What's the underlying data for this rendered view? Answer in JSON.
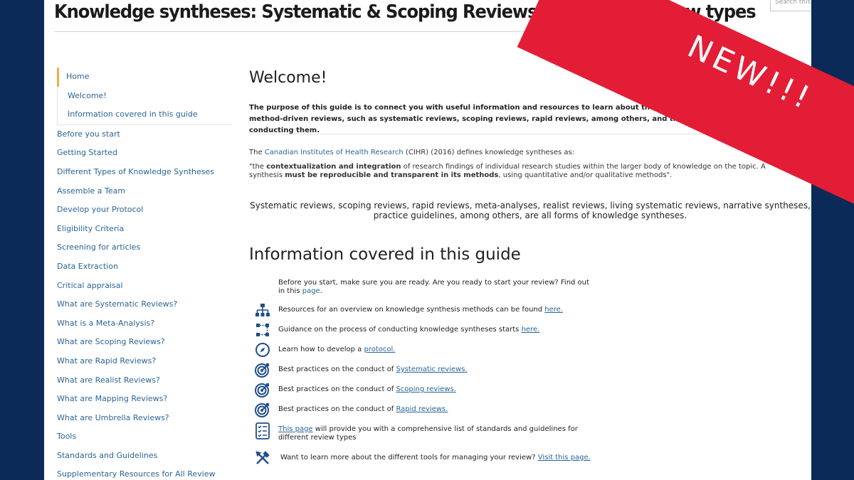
{
  "header": {
    "title": "Knowledge syntheses: Systematic & Scoping Reviews, and other review types",
    "search_placeholder": "Search this"
  },
  "banner": {
    "text": "NEW!!!",
    "color": "#e31d36"
  },
  "sidebar": {
    "items": [
      {
        "label": "Home",
        "type": "home"
      },
      {
        "label": "Welcome!",
        "type": "sub"
      },
      {
        "label": "Information covered in this guide",
        "type": "sub-last"
      },
      {
        "label": "Before you start",
        "type": "top"
      },
      {
        "label": "Getting Started",
        "type": "top"
      },
      {
        "label": "Different Types of Knowledge Syntheses",
        "type": "top"
      },
      {
        "label": "Assemble a Team",
        "type": "top"
      },
      {
        "label": "Develop your Protocol",
        "type": "top"
      },
      {
        "label": "Eligibility Criteria",
        "type": "top"
      },
      {
        "label": "Screening for articles",
        "type": "top"
      },
      {
        "label": "Data Extraction",
        "type": "top"
      },
      {
        "label": "Critical appraisal",
        "type": "top"
      },
      {
        "label": "What are Systematic Reviews?",
        "type": "top"
      },
      {
        "label": "What is a Meta-Analysis?",
        "type": "top"
      },
      {
        "label": "What are Scoping Reviews?",
        "type": "top"
      },
      {
        "label": "What are Rapid Reviews?",
        "type": "top"
      },
      {
        "label": "What are Realist Reviews?",
        "type": "top"
      },
      {
        "label": "What are Mapping Reviews?",
        "type": "top"
      },
      {
        "label": "What are Umbrella Reviews?",
        "type": "top"
      },
      {
        "label": "Tools",
        "type": "top"
      },
      {
        "label": "Standards and Guidelines",
        "type": "top"
      },
      {
        "label": "Supplementary Resources for All Review",
        "type": "top"
      }
    ]
  },
  "main": {
    "welcome_heading": "Welcome!",
    "purpose": "The purpose of this guide is to connect you with useful information and resources to learn about the different types of method-driven reviews, such as systematic reviews, scoping reviews, rapid reviews, among others, and the process of conducting them.",
    "cihr_prefix": "The ",
    "cihr_link": "Canadian Institutes of Health Research",
    "cihr_suffix": " (CIHR) (2016) defines knowledge syntheses as:",
    "quote_1": "\"the ",
    "quote_bold_1": "contextualization and integration",
    "quote_2": " of research findings of individual research studies within the larger body of knowledge on the topic. A synthesis ",
    "quote_bold_2": "must be reproducible and transparent in its methods",
    "quote_3": ", using quantitative and/or qualitative methods\".",
    "types_text": "Systematic reviews, scoping reviews, rapid reviews, meta-analyses, realist reviews, living systematic reviews, narrative syntheses, practice guidelines, among others, are all forms of knowledge syntheses.",
    "covered_heading": "Information covered in this guide",
    "info_items": [
      {
        "icon": "none",
        "before": "Before you start, make sure you are ready. Are you ready to start your review? Find out in this ",
        "link": "page",
        "after": ".",
        "plain_link": true
      },
      {
        "icon": "hierarchy-icon",
        "before": "Resources for an overview on knowledge synthesis methods can be found ",
        "link": "here.",
        "after": ""
      },
      {
        "icon": "workflow-icon",
        "before": "Guidance on the process of conducting knowledge syntheses starts ",
        "link": "here.",
        "after": ""
      },
      {
        "icon": "compass-icon",
        "before": "Learn how to develop a ",
        "link": "protocol.",
        "after": ""
      },
      {
        "icon": "target-icon",
        "before": "Best practices on the conduct of ",
        "link": "Systematic reviews.",
        "after": ""
      },
      {
        "icon": "target-icon",
        "before": "Best practices on the conduct of ",
        "link": "Scoping reviews.",
        "after": ""
      },
      {
        "icon": "target-icon",
        "before": "Best practices on the conduct of ",
        "link": "Rapid reviews.",
        "after": ""
      },
      {
        "icon": "checklist-icon",
        "before": "",
        "link": "This page",
        "after": " will provide you with a comprehensive list of standards and guidelines for different review types"
      },
      {
        "icon": "tools-icon",
        "before": "Want to learn more about the different tools for managing your review? ",
        "link": "Visit this page.",
        "after": ""
      }
    ]
  },
  "colors": {
    "background": "#0b2a57",
    "link": "#2a6496",
    "icon": "#1f4e8c",
    "home_accent": "#f0ad4e"
  }
}
